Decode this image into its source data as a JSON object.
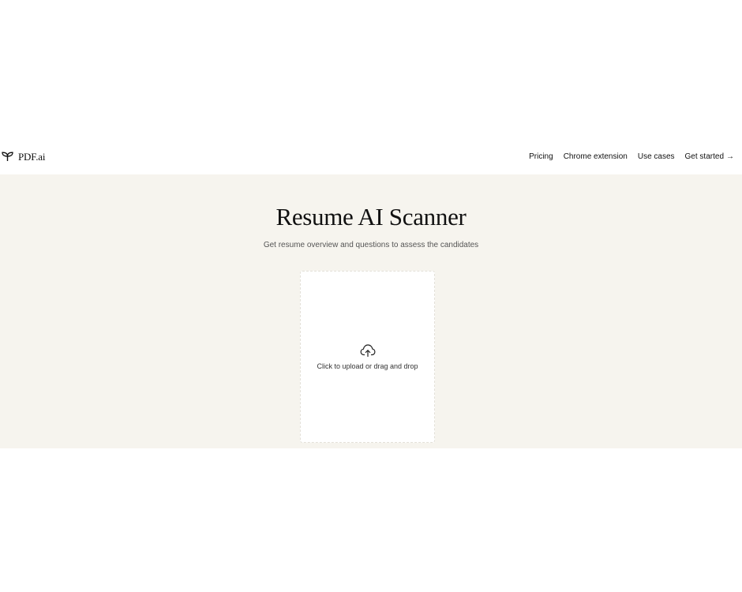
{
  "brand": {
    "name": "PDF.ai",
    "icon": "sprout-icon"
  },
  "nav": {
    "items": [
      {
        "label": "Pricing"
      },
      {
        "label": "Chrome extension"
      },
      {
        "label": "Use cases"
      },
      {
        "label": "Get started",
        "icon": "arrow-right-icon",
        "arrow": "→"
      }
    ]
  },
  "hero": {
    "title": "Resume AI Scanner",
    "subtitle": "Get resume overview and questions to assess the candidates"
  },
  "upload": {
    "icon": "cloud-upload-icon",
    "label": "Click to upload or drag and drop"
  },
  "colors": {
    "hero_background": "#f6f4ee",
    "page_background": "#ffffff",
    "text": "#111111"
  }
}
